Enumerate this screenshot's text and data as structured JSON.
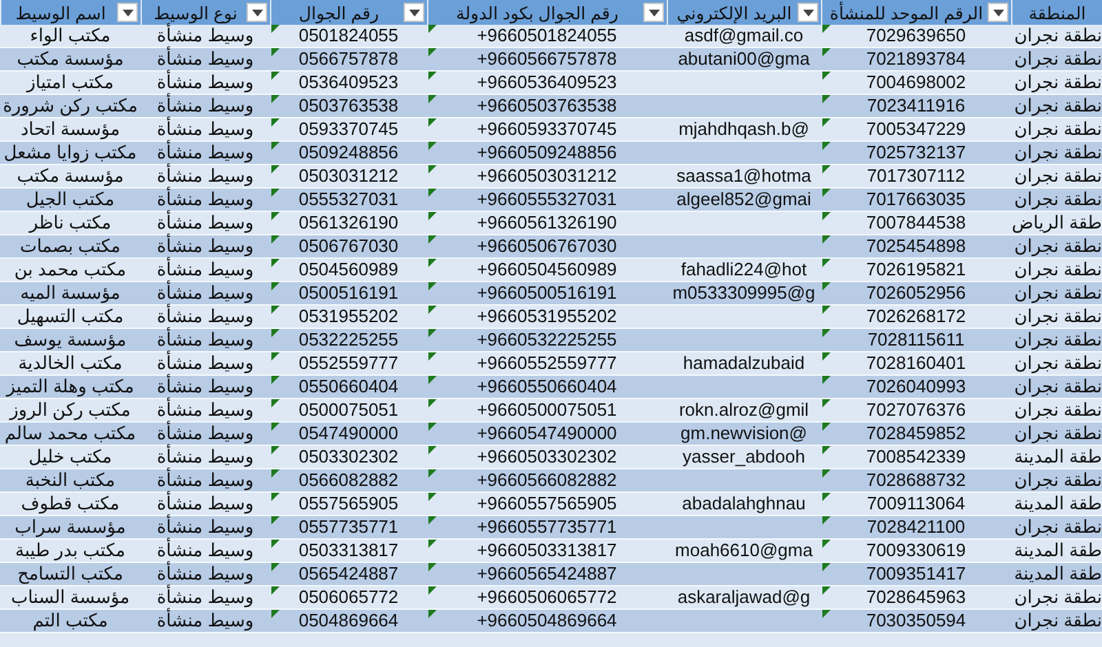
{
  "table": {
    "columns": [
      {
        "label": "المنطقة",
        "filter_button": false,
        "error_flag": false
      },
      {
        "label": "الرقم الموحد للمنشأة",
        "filter_button": true,
        "error_flag": true
      },
      {
        "label": "البريد الإلكتروني",
        "filter_button": true,
        "error_flag": false
      },
      {
        "label": "رقم الجوال بكود الدولة",
        "filter_button": true,
        "error_flag": true
      },
      {
        "label": "رقم الجوال",
        "filter_button": true,
        "error_flag": true
      },
      {
        "label": "نوع الوسيط",
        "filter_button": true,
        "error_flag": false
      },
      {
        "label": "اسم الوسيط",
        "filter_button": true,
        "error_flag": false
      }
    ],
    "rows": [
      [
        "نطقة نجران",
        "7029639650",
        "asdf@gmail.co",
        "+9660501824055",
        "0501824055",
        "وسيط منشأة",
        "مكتب الواء"
      ],
      [
        "نطقة نجران",
        "7021893784",
        "abutani00@gma",
        "+9660566757878",
        "0566757878",
        "وسيط منشأة",
        "مؤسسة مكتب"
      ],
      [
        "نطقة نجران",
        "7004698002",
        null,
        "+9660536409523",
        "0536409523",
        "وسيط منشأة",
        "مكتب امتياز"
      ],
      [
        "نطقة نجران",
        "7023411916",
        null,
        "+9660503763538",
        "0503763538",
        "وسيط منشأة",
        "مكتب ركن شرورة"
      ],
      [
        "نطقة نجران",
        "7005347229",
        "mjahdhqash.b@",
        "+9660593370745",
        "0593370745",
        "وسيط منشأة",
        "مؤسسة اتحاد"
      ],
      [
        "نطقة نجران",
        "7025732137",
        null,
        "+9660509248856",
        "0509248856",
        "وسيط منشأة",
        "مكتب زوايا مشعل"
      ],
      [
        "نطقة نجران",
        "7017307112",
        "saassa1@hotma",
        "+9660503031212",
        "0503031212",
        "وسيط منشأة",
        "مؤسسة مكتب"
      ],
      [
        "نطقة نجران",
        "7017663035",
        "algeel852@gmai",
        "+9660555327031",
        "0555327031",
        "وسيط منشأة",
        "مكتب الجيل"
      ],
      [
        "طقة الرياض",
        "7007844538",
        null,
        "+9660561326190",
        "0561326190",
        "وسيط منشأة",
        "مكتب ناظر"
      ],
      [
        "نطقة نجران",
        "7025454898",
        null,
        "+9660506767030",
        "0506767030",
        "وسيط منشأة",
        "مكتب بصمات"
      ],
      [
        "نطقة نجران",
        "7026195821",
        "fahadli224@hot",
        "+9660504560989",
        "0504560989",
        "وسيط منشأة",
        "مكتب محمد بن"
      ],
      [
        "نطقة نجران",
        "7026052956",
        "m0533309995@g",
        "+9660500516191",
        "0500516191",
        "وسيط منشأة",
        "مؤسسة الميه"
      ],
      [
        "نطقة نجران",
        "7026268172",
        null,
        "+9660531955202",
        "0531955202",
        "وسيط منشأة",
        "مكتب التسهيل"
      ],
      [
        "نطقة نجران",
        "7028115611",
        null,
        "+9660532225255",
        "0532225255",
        "وسيط منشأة",
        "مؤسسة يوسف"
      ],
      [
        "نطقة نجران",
        "7028160401",
        "hamadalzubaid",
        "+9660552559777",
        "0552559777",
        "وسيط منشأة",
        "مكتب الخالدية"
      ],
      [
        "نطقة نجران",
        "7026040993",
        null,
        "+9660550660404",
        "0550660404",
        "وسيط منشأة",
        "مكتب وهلة التميز"
      ],
      [
        "نطقة نجران",
        "7027076376",
        "rokn.alroz@gmil",
        "+9660500075051",
        "0500075051",
        "وسيط منشأة",
        "مكتب ركن الروز"
      ],
      [
        "نطقة نجران",
        "7028459852",
        "gm.newvision@",
        "+9660547490000",
        "0547490000",
        "وسيط منشأة",
        "مكتب محمد سالم"
      ],
      [
        "طقة المدينة",
        "7008542339",
        "yasser_abdooh",
        "+9660503302302",
        "0503302302",
        "وسيط منشأة",
        "مكتب خليل"
      ],
      [
        "نطقة نجران",
        "7028688732",
        null,
        "+9660566082882",
        "0566082882",
        "وسيط منشأة",
        "مكتب النخبة"
      ],
      [
        "طقة المدينة",
        "7009113064",
        "abadalahghnau",
        "+9660557565905",
        "0557565905",
        "وسيط منشأة",
        "مكتب قطوف"
      ],
      [
        "نطقة نجران",
        "7028421100",
        null,
        "+9660557735771",
        "0557735771",
        "وسيط منشأة",
        "مؤسسة سراب"
      ],
      [
        "طقة المدينة",
        "7009330619",
        "moah6610@gma",
        "+9660503313817",
        "0503313817",
        "وسيط منشأة",
        "مكتب بدر طيبة"
      ],
      [
        "طقة المدينة",
        "7009351417",
        null,
        "+9660565424887",
        "0565424887",
        "وسيط منشأة",
        "مكتب التسامح"
      ],
      [
        "نطقة نجران",
        "7028645963",
        "askaraljawad@g",
        "+9660506065772",
        "0506065772",
        "وسيط منشأة",
        "مؤسسة السناب"
      ],
      [
        "نطقة نجران",
        "7030350594",
        null,
        "+9660504869664",
        "0504869664",
        "وسيط منشأة",
        "مكتب التم"
      ]
    ]
  }
}
